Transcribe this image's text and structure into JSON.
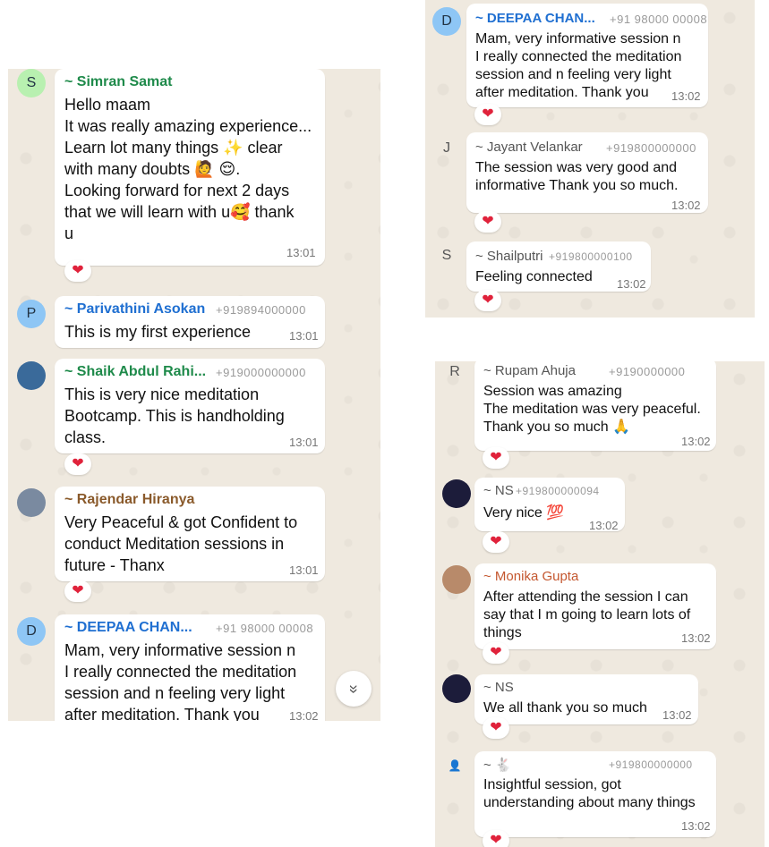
{
  "panel_left": {
    "messages": [
      {
        "avatar": "S",
        "name": "~ Simran Samat",
        "phone": "",
        "text": "Hello maam\nIt was really amazing experience...\nLearn lot many things ✨ clear\nwith many doubts 🙋 😌.\nLooking forward for next 2 days\nthat we will learn with u🥰 thank\nu",
        "time": "13:01",
        "reaction": "❤"
      },
      {
        "avatar": "P",
        "name": "~ Parivathini Asokan",
        "phone": "+919894000000",
        "text": "This is my first experience",
        "time": "13:01",
        "reaction": ""
      },
      {
        "avatar": "",
        "name": "~ Shaik Abdul Rahi...",
        "phone": "+919000000000",
        "text": "This is very nice meditation\nBootcamp. This is handholding\nclass.",
        "time": "13:01",
        "reaction": "❤"
      },
      {
        "avatar": "",
        "name": "~ Rajendar Hiranya",
        "phone": "",
        "text": "Very Peaceful & got Confident to\nconduct Meditation sessions in\nfuture - Thanx",
        "time": "13:01",
        "reaction": "❤"
      },
      {
        "avatar": "D",
        "name": "~ DEEPAA CHAN...",
        "phone": "+91 98000 00008",
        "text": "Mam, very informative session n\nI really connected the meditation\nsession and n feeling very light\nafter meditation. Thank you",
        "time": "13:02",
        "reaction": ""
      }
    ],
    "scroll_icon": "»"
  },
  "panel_top_right": {
    "messages": [
      {
        "avatar": "D",
        "name": "~ DEEPAA CHAN...",
        "phone": "+91 98000 00008",
        "text": "Mam, very informative session n\nI really connected the meditation\nsession and n feeling very light\nafter meditation. Thank you",
        "time": "13:02",
        "reaction": "❤"
      },
      {
        "avatar": "J",
        "name": "~ Jayant Velankar",
        "phone": "+919800000000",
        "text": "The session was very good and\ninformative Thank you so much.",
        "time": "13:02",
        "reaction": "❤"
      },
      {
        "avatar": "S",
        "name": "~ Shailputri",
        "phone": "+919800000100",
        "text": "Feeling connected",
        "time": "13:02",
        "reaction": "❤"
      }
    ]
  },
  "panel_bottom_right": {
    "messages": [
      {
        "avatar": "R",
        "name": "~ Rupam Ahuja",
        "phone": "+9190000000",
        "text": "Session was amazing\nThe meditation was very peaceful.\nThank you so much 🙏",
        "time": "13:02",
        "reaction": "❤"
      },
      {
        "avatar": "",
        "name": "~ NS",
        "phone": "+919800000094",
        "text": "Very nice 💯",
        "time": "13:02",
        "reaction": "❤"
      },
      {
        "avatar": "",
        "name": "~ Monika Gupta",
        "phone": "",
        "text": "After attending the session I can\nsay that I m going to learn lots of\nthings",
        "time": "13:02",
        "reaction": "❤"
      },
      {
        "avatar": "",
        "name": "~ NS",
        "phone": "",
        "text": "We all thank you so much",
        "time": "13:02",
        "reaction": "❤"
      },
      {
        "avatar": "👤",
        "name": "~ 🐇",
        "phone": "+919800000000",
        "text": "Insightful session, got\nunderstanding about many things",
        "time": "13:02",
        "reaction": "❤"
      }
    ]
  },
  "colors": {
    "chat_background": "#efe9df",
    "bubble": "#ffffff",
    "heart": "#e0223b",
    "name_green": "#1e8a4a",
    "name_blue": "#1f6fd1",
    "name_brown": "#8a5a2b",
    "name_gray": "#555555",
    "name_orange": "#c4572f"
  }
}
